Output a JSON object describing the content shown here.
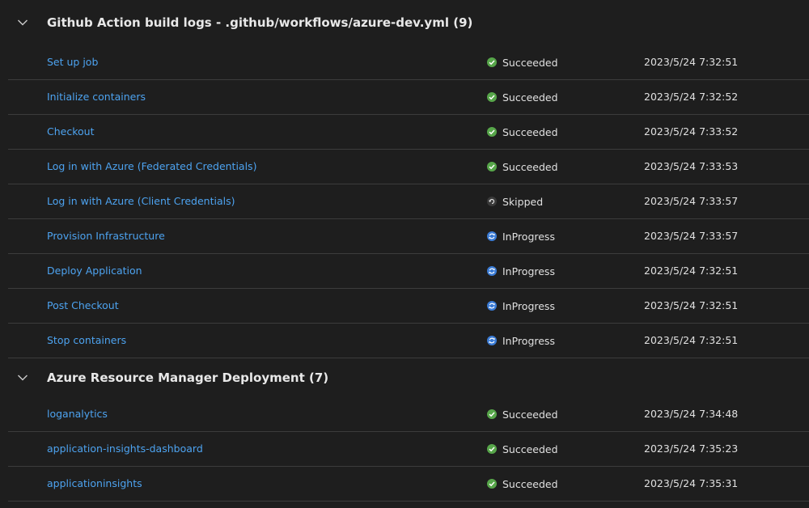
{
  "groups": [
    {
      "title": "Github Action build logs - .github/workflows/azure-dev.yml (9)",
      "expanded": true,
      "rows": [
        {
          "name": "Set up job",
          "status": "Succeeded",
          "status_icon": "check-circle-icon",
          "time": "2023/5/24 7:32:51"
        },
        {
          "name": "Initialize containers",
          "status": "Succeeded",
          "status_icon": "check-circle-icon",
          "time": "2023/5/24 7:32:52"
        },
        {
          "name": "Checkout",
          "status": "Succeeded",
          "status_icon": "check-circle-icon",
          "time": "2023/5/24 7:33:52"
        },
        {
          "name": "Log in with Azure (Federated Credentials)",
          "status": "Succeeded",
          "status_icon": "check-circle-icon",
          "time": "2023/5/24 7:33:53"
        },
        {
          "name": "Log in with Azure (Client Credentials)",
          "status": "Skipped",
          "status_icon": "skipped-icon",
          "time": "2023/5/24 7:33:57"
        },
        {
          "name": "Provision Infrastructure",
          "status": "InProgress",
          "status_icon": "in-progress-icon",
          "time": "2023/5/24 7:33:57"
        },
        {
          "name": "Deploy Application",
          "status": "InProgress",
          "status_icon": "in-progress-icon",
          "time": "2023/5/24 7:32:51"
        },
        {
          "name": "Post Checkout",
          "status": "InProgress",
          "status_icon": "in-progress-icon",
          "time": "2023/5/24 7:32:51"
        },
        {
          "name": "Stop containers",
          "status": "InProgress",
          "status_icon": "in-progress-icon",
          "time": "2023/5/24 7:32:51"
        }
      ]
    },
    {
      "title": "Azure Resource Manager Deployment (7)",
      "expanded": true,
      "rows": [
        {
          "name": "loganalytics",
          "status": "Succeeded",
          "status_icon": "check-circle-icon",
          "time": "2023/5/24 7:34:48"
        },
        {
          "name": "application-insights-dashboard",
          "status": "Succeeded",
          "status_icon": "check-circle-icon",
          "time": "2023/5/24 7:35:23"
        },
        {
          "name": "applicationinsights",
          "status": "Succeeded",
          "status_icon": "check-circle-icon",
          "time": "2023/5/24 7:35:31"
        }
      ]
    }
  ],
  "colors": {
    "background": "#1e1e1e",
    "link": "#4da3f0",
    "success": "#57a64a",
    "in_progress": "#3a7bd5",
    "skipped": "#3a3a3a",
    "divider": "#3c3c3c"
  }
}
